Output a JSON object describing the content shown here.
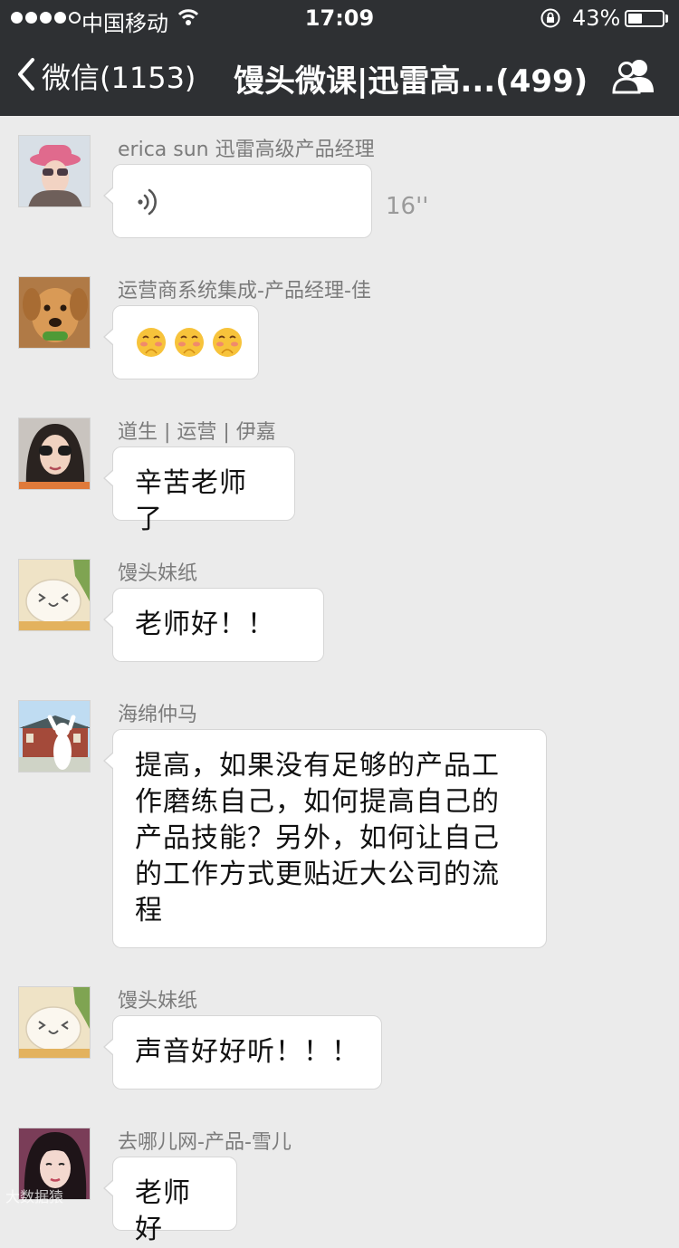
{
  "status_bar": {
    "carrier": "中国移动",
    "time": "17:09",
    "battery_percent": "43%",
    "battery_level": 0.43,
    "signal_bars": 4,
    "signal_max": 5
  },
  "nav": {
    "back_label": "微信(1153)",
    "title": "馒头微课|迅雷高...(499)",
    "back_icon": "chevron-left-icon",
    "members_icon": "group-members-icon"
  },
  "messages": [
    {
      "sender": "erica sun  迅雷高级产品经理",
      "type": "voice",
      "duration": "16''"
    },
    {
      "sender": "运营商系统集成-产品经理-佳",
      "type": "emoji",
      "emoji": [
        "🤭",
        "🤭",
        "🤭"
      ]
    },
    {
      "sender": "道生 | 运营 | 伊嘉",
      "type": "text",
      "text": "辛苦老师了"
    },
    {
      "sender": "馒头妹纸",
      "type": "text",
      "text": "老师好！！"
    },
    {
      "sender": "海绵仲马",
      "type": "text",
      "text": "提高，如果没有足够的产品工\n作磨练自己，如何提高自己的\n产品技能？另外，如何让自己\n的工作方式更贴近大公司的流\n程"
    },
    {
      "sender": "馒头妹纸",
      "type": "text",
      "text": "声音好好听！！！"
    },
    {
      "sender": "去哪儿网-产品-雪儿",
      "type": "text",
      "text": "老师好"
    }
  ],
  "watermark": "大数据猿"
}
